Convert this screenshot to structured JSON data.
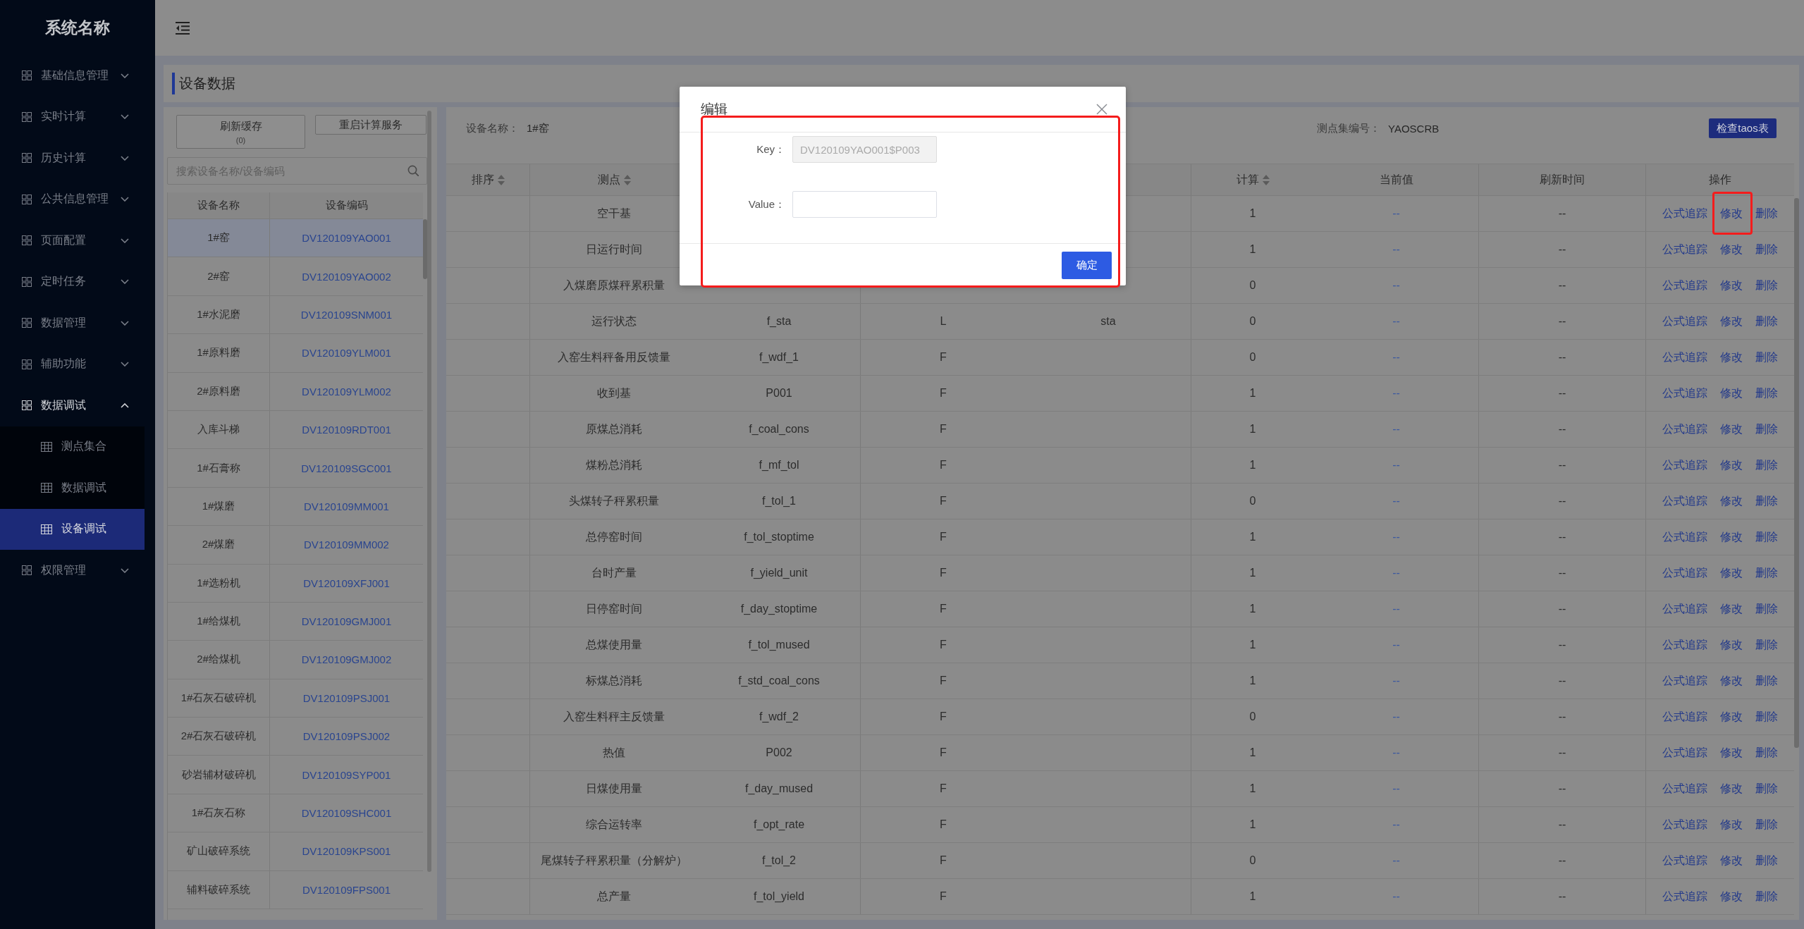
{
  "sidebar": {
    "logo": "系统名称",
    "items": [
      {
        "label": "基础信息管理",
        "expanded": false
      },
      {
        "label": "实时计算",
        "expanded": false
      },
      {
        "label": "历史计算",
        "expanded": false
      },
      {
        "label": "公共信息管理",
        "expanded": false
      },
      {
        "label": "页面配置",
        "expanded": false
      },
      {
        "label": "定时任务",
        "expanded": false
      },
      {
        "label": "数据管理",
        "expanded": false
      },
      {
        "label": "辅助功能",
        "expanded": false
      },
      {
        "label": "数据调试",
        "expanded": true,
        "children": [
          {
            "label": "测点集合",
            "selected": false
          },
          {
            "label": "数据调试",
            "selected": false
          },
          {
            "label": "设备调试",
            "selected": true
          }
        ]
      },
      {
        "label": "权限管理",
        "expanded": false
      }
    ]
  },
  "page_title": "设备数据",
  "device_panel": {
    "buttons": [
      {
        "label": "刷新缓存",
        "count": "(0)"
      },
      {
        "label": "重启计算服务"
      }
    ],
    "search": {
      "placeholder": "搜索设备名称/设备编码"
    },
    "columns": [
      "设备名称",
      "设备编码"
    ],
    "rows": [
      {
        "name": "1#窑",
        "code": "DV120109YAO001",
        "selected": true
      },
      {
        "name": "2#窑",
        "code": "DV120109YAO002",
        "selected": false
      },
      {
        "name": "1#水泥磨",
        "code": "DV120109SNM001",
        "selected": false
      },
      {
        "name": "1#原料磨",
        "code": "DV120109YLM001",
        "selected": false
      },
      {
        "name": "2#原料磨",
        "code": "DV120109YLM002",
        "selected": false
      },
      {
        "name": "入库斗梯",
        "code": "DV120109RDT001",
        "selected": false
      },
      {
        "name": "1#石膏称",
        "code": "DV120109SGC001",
        "selected": false
      },
      {
        "name": "1#煤磨",
        "code": "DV120109MM001",
        "selected": false
      },
      {
        "name": "2#煤磨",
        "code": "DV120109MM002",
        "selected": false
      },
      {
        "name": "1#选粉机",
        "code": "DV120109XFJ001",
        "selected": false
      },
      {
        "name": "1#给煤机",
        "code": "DV120109GMJ001",
        "selected": false
      },
      {
        "name": "2#给煤机",
        "code": "DV120109GMJ002",
        "selected": false
      },
      {
        "name": "1#石灰石破碎机",
        "code": "DV120109PSJ001",
        "selected": false
      },
      {
        "name": "2#石灰石破碎机",
        "code": "DV120109PSJ002",
        "selected": false
      },
      {
        "name": "砂岩辅材破碎机",
        "code": "DV120109SYP001",
        "selected": false
      },
      {
        "name": "1#石灰石称",
        "code": "DV120109SHC001",
        "selected": false
      },
      {
        "name": "矿山破碎系统",
        "code": "DV120109KPS001",
        "selected": false
      },
      {
        "name": "辅料破碎系统",
        "code": "DV120109FPS001",
        "selected": false
      }
    ]
  },
  "detail": {
    "fields": [
      {
        "label": "设备名称：",
        "value": "1#窑"
      },
      {
        "label": "测点集编号：",
        "value": "YAOSCRB"
      }
    ],
    "check_button": "检查taos表",
    "columns": [
      {
        "label": "排序",
        "sortable": true
      },
      {
        "label": "测点",
        "sortable": true
      },
      {
        "label": "计算",
        "sortable": true
      },
      {
        "label": "当前值"
      },
      {
        "label": "刷新时间"
      },
      {
        "label": "操作"
      }
    ],
    "rows": [
      {
        "name": "空干基",
        "calc": "1",
        "current": "--",
        "refresh_time": "--",
        "actions": [
          {
            "label": "公式追踪",
            "highlighted": false
          },
          {
            "label": "修改",
            "highlighted": true
          },
          {
            "label": "删除",
            "highlighted": false
          }
        ]
      },
      {
        "name": "日运行时间",
        "calc": "1",
        "current": "--",
        "refresh_time": "--",
        "actions": [
          {
            "label": "公式追踪",
            "highlighted": false
          },
          {
            "label": "修改",
            "highlighted": false
          },
          {
            "label": "删除",
            "highlighted": false
          }
        ]
      },
      {
        "name": "入煤磨原煤秤累积量",
        "calc": "0",
        "current": "--",
        "refresh_time": "--",
        "actions": [
          {
            "label": "公式追踪",
            "highlighted": false
          },
          {
            "label": "修改",
            "highlighted": false
          },
          {
            "label": "删除",
            "highlighted": false
          }
        ]
      },
      {
        "name": "运行状态",
        "column_3": "f_sta",
        "column_4": "L",
        "column_5": "sta",
        "calc": "0",
        "current": "--",
        "refresh_time": "--",
        "actions": [
          {
            "label": "公式追踪",
            "highlighted": false
          },
          {
            "label": "修改",
            "highlighted": false
          },
          {
            "label": "删除",
            "highlighted": false
          }
        ]
      },
      {
        "name": "入窑生料秤备用反馈量",
        "column_3": "f_wdf_1",
        "column_4": "F",
        "calc": "0",
        "current": "--",
        "refresh_time": "--",
        "actions": [
          {
            "label": "公式追踪",
            "highlighted": false
          },
          {
            "label": "修改",
            "highlighted": false
          },
          {
            "label": "删除",
            "highlighted": false
          }
        ]
      },
      {
        "name": "收到基",
        "column_3": "P001",
        "column_4": "F",
        "calc": "1",
        "current": "--",
        "refresh_time": "--",
        "actions": [
          {
            "label": "公式追踪",
            "highlighted": false
          },
          {
            "label": "修改",
            "highlighted": false
          },
          {
            "label": "删除",
            "highlighted": false
          }
        ]
      },
      {
        "name": "原煤总消耗",
        "column_3": "f_coal_cons",
        "column_4": "F",
        "calc": "1",
        "current": "--",
        "refresh_time": "--",
        "actions": [
          {
            "label": "公式追踪",
            "highlighted": false
          },
          {
            "label": "修改",
            "highlighted": false
          },
          {
            "label": "删除",
            "highlighted": false
          }
        ]
      },
      {
        "name": "煤粉总消耗",
        "column_3": "f_mf_tol",
        "column_4": "F",
        "calc": "1",
        "current": "--",
        "refresh_time": "--",
        "actions": [
          {
            "label": "公式追踪",
            "highlighted": false
          },
          {
            "label": "修改",
            "highlighted": false
          },
          {
            "label": "删除",
            "highlighted": false
          }
        ]
      },
      {
        "name": "头煤转子秤累积量",
        "column_3": "f_tol_1",
        "column_4": "F",
        "calc": "0",
        "current": "--",
        "refresh_time": "--",
        "actions": [
          {
            "label": "公式追踪",
            "highlighted": false
          },
          {
            "label": "修改",
            "highlighted": false
          },
          {
            "label": "删除",
            "highlighted": false
          }
        ]
      },
      {
        "name": "总停窑时间",
        "column_3": "f_tol_stoptime",
        "column_4": "F",
        "calc": "1",
        "current": "--",
        "refresh_time": "--",
        "actions": [
          {
            "label": "公式追踪",
            "highlighted": false
          },
          {
            "label": "修改",
            "highlighted": false
          },
          {
            "label": "删除",
            "highlighted": false
          }
        ]
      },
      {
        "name": "台时产量",
        "column_3": "f_yield_unit",
        "column_4": "F",
        "calc": "1",
        "current": "--",
        "refresh_time": "--",
        "actions": [
          {
            "label": "公式追踪",
            "highlighted": false
          },
          {
            "label": "修改",
            "highlighted": false
          },
          {
            "label": "删除",
            "highlighted": false
          }
        ]
      },
      {
        "name": "日停窑时间",
        "column_3": "f_day_stoptime",
        "column_4": "F",
        "calc": "1",
        "current": "--",
        "refresh_time": "--",
        "actions": [
          {
            "label": "公式追踪",
            "highlighted": false
          },
          {
            "label": "修改",
            "highlighted": false
          },
          {
            "label": "删除",
            "highlighted": false
          }
        ]
      },
      {
        "name": "总煤使用量",
        "column_3": "f_tol_mused",
        "column_4": "F",
        "calc": "1",
        "current": "--",
        "refresh_time": "--",
        "actions": [
          {
            "label": "公式追踪",
            "highlighted": false
          },
          {
            "label": "修改",
            "highlighted": false
          },
          {
            "label": "删除",
            "highlighted": false
          }
        ]
      },
      {
        "name": "标煤总消耗",
        "column_3": "f_std_coal_cons",
        "column_4": "F",
        "calc": "1",
        "current": "--",
        "refresh_time": "--",
        "actions": [
          {
            "label": "公式追踪",
            "highlighted": false
          },
          {
            "label": "修改",
            "highlighted": false
          },
          {
            "label": "删除",
            "highlighted": false
          }
        ]
      },
      {
        "name": "入窑生料秤主反馈量",
        "column_3": "f_wdf_2",
        "column_4": "F",
        "calc": "0",
        "current": "--",
        "refresh_time": "--",
        "actions": [
          {
            "label": "公式追踪",
            "highlighted": false
          },
          {
            "label": "修改",
            "highlighted": false
          },
          {
            "label": "删除",
            "highlighted": false
          }
        ]
      },
      {
        "name": "热值",
        "column_3": "P002",
        "column_4": "F",
        "calc": "1",
        "current": "--",
        "refresh_time": "--",
        "actions": [
          {
            "label": "公式追踪",
            "highlighted": false
          },
          {
            "label": "修改",
            "highlighted": false
          },
          {
            "label": "删除",
            "highlighted": false
          }
        ]
      },
      {
        "name": "日煤使用量",
        "column_3": "f_day_mused",
        "column_4": "F",
        "calc": "1",
        "current": "--",
        "refresh_time": "--",
        "actions": [
          {
            "label": "公式追踪",
            "highlighted": false
          },
          {
            "label": "修改",
            "highlighted": false
          },
          {
            "label": "删除",
            "highlighted": false
          }
        ]
      },
      {
        "name": "综合运转率",
        "column_3": "f_opt_rate",
        "column_4": "F",
        "calc": "1",
        "current": "--",
        "refresh_time": "--",
        "actions": [
          {
            "label": "公式追踪",
            "highlighted": false
          },
          {
            "label": "修改",
            "highlighted": false
          },
          {
            "label": "删除",
            "highlighted": false
          }
        ]
      },
      {
        "name": "尾煤转子秤累积量（分解炉）",
        "column_3": "f_tol_2",
        "column_4": "F",
        "calc": "0",
        "current": "--",
        "refresh_time": "--",
        "actions": [
          {
            "label": "公式追踪",
            "highlighted": false
          },
          {
            "label": "修改",
            "highlighted": false
          },
          {
            "label": "删除",
            "highlighted": false
          }
        ]
      },
      {
        "name": "总产量",
        "column_3": "f_tol_yield",
        "column_4": "F",
        "calc": "1",
        "current": "--",
        "refresh_time": "--",
        "actions": [
          {
            "label": "公式追踪",
            "highlighted": false
          },
          {
            "label": "修改",
            "highlighted": false
          },
          {
            "label": "删除",
            "highlighted": false
          }
        ]
      }
    ]
  },
  "modal": {
    "title": "编辑",
    "fields": [
      {
        "label": "Key：",
        "value": "DV120109YAO001$P003",
        "disabled": true
      },
      {
        "label": "Value："
      }
    ],
    "confirm": "确定",
    "highlighted": true
  }
}
